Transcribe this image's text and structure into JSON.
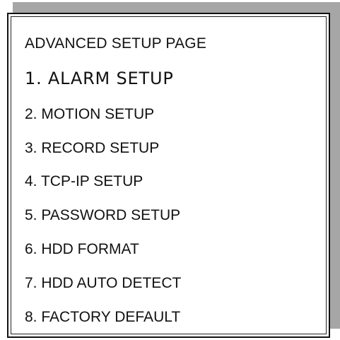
{
  "menu": {
    "title": "ADVANCED SETUP PAGE",
    "selected_index": 0,
    "items": [
      {
        "label": "1. ALARM SETUP"
      },
      {
        "label": "2. MOTION SETUP"
      },
      {
        "label": "3. RECORD SETUP"
      },
      {
        "label": "4. TCP-IP SETUP"
      },
      {
        "label": "5. PASSWORD SETUP"
      },
      {
        "label": "6. HDD FORMAT"
      },
      {
        "label": "7. HDD AUTO DETECT"
      },
      {
        "label": "8. FACTORY DEFAULT"
      }
    ]
  },
  "colors": {
    "shadow": "#a6a6a6",
    "frame_border": "#111111",
    "background": "#ffffff",
    "text": "#111111"
  }
}
